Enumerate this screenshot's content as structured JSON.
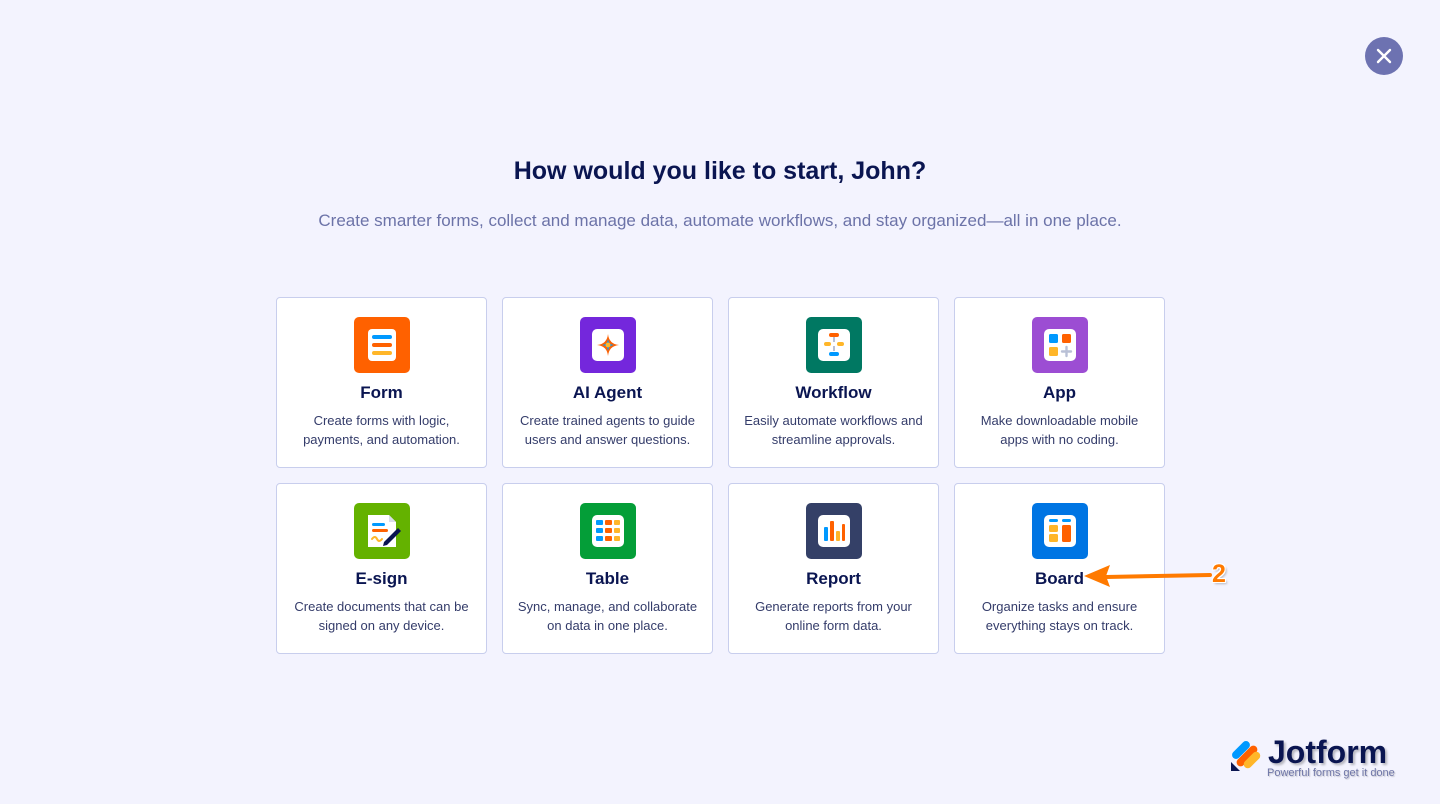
{
  "header": {
    "title": "How would you like to start, John?",
    "subtitle": "Create smarter forms, collect and manage data, automate workflows, and stay organized—all in one place."
  },
  "close_icon": "close-icon",
  "cards": [
    {
      "id": "form",
      "title": "Form",
      "description": "Create forms with logic, payments, and automation.",
      "icon": "form-icon",
      "color": "#ff6100"
    },
    {
      "id": "ai-agent",
      "title": "AI Agent",
      "description": "Create trained agents to guide users and answer questions.",
      "icon": "ai-agent-icon",
      "color": "#7427dc"
    },
    {
      "id": "workflow",
      "title": "Workflow",
      "description": "Easily automate workflows and streamline approvals.",
      "icon": "workflow-icon",
      "color": "#007862"
    },
    {
      "id": "app",
      "title": "App",
      "description": "Make downloadable mobile apps with no coding.",
      "icon": "app-icon",
      "color": "#9c4dd3"
    },
    {
      "id": "e-sign",
      "title": "E-sign",
      "description": "Create documents that can be signed on any device.",
      "icon": "e-sign-icon",
      "color": "#64b200"
    },
    {
      "id": "table",
      "title": "Table",
      "description": "Sync, manage, and collaborate on data in one place.",
      "icon": "table-icon",
      "color": "#049e38"
    },
    {
      "id": "report",
      "title": "Report",
      "description": "Generate reports from your online form data.",
      "icon": "report-icon",
      "color": "#344067"
    },
    {
      "id": "board",
      "title": "Board",
      "description": "Organize tasks and ensure everything stays on track.",
      "icon": "board-icon",
      "color": "#0075e3"
    }
  ],
  "annotation": {
    "label": "2",
    "color": "#ff7a00"
  },
  "branding": {
    "name": "Jotform",
    "tagline": "Powerful forms get it done"
  }
}
